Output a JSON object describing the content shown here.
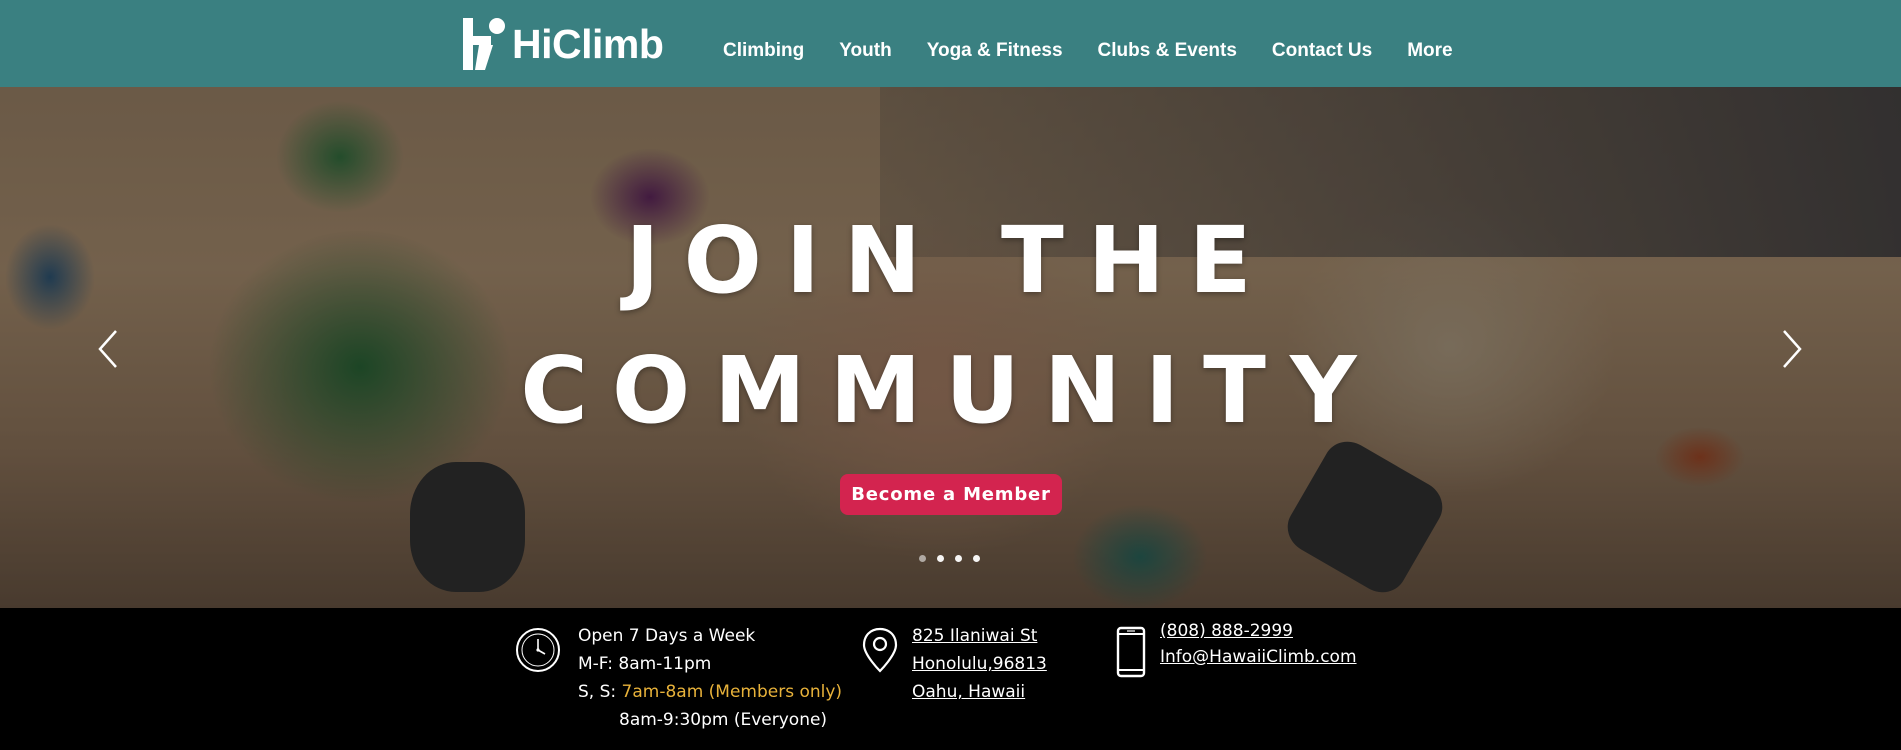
{
  "brand": {
    "name": "HiClimb"
  },
  "nav": {
    "items": [
      {
        "label": "Climbing"
      },
      {
        "label": "Youth"
      },
      {
        "label": "Yoga & Fitness"
      },
      {
        "label": "Clubs & Events"
      },
      {
        "label": "Contact Us"
      },
      {
        "label": "More"
      }
    ]
  },
  "hero": {
    "title_line1": "JOIN THE",
    "title_line2": "COMMUNITY",
    "cta_label": "Become a Member",
    "slide_count": 4,
    "active_slide": 2
  },
  "hours": {
    "line1": "Open 7 Days a Week",
    "line2": "M-F: 8am-11pm",
    "weekend_prefix": "S, S: ",
    "weekend_members": "7am-8am (Members only)",
    "weekend_everyone": "8am-9:30pm (Everyone)"
  },
  "address": {
    "street": "825 Ilaniwai St ",
    "city": "Honolulu,96813 ",
    "region": "Oahu, Hawaii"
  },
  "contact": {
    "phone": "(808) 888-2999 ",
    "email": "Info@HawaiiClimb.com"
  },
  "colors": {
    "header_bg": "#3a8081",
    "cta_bg": "#d3244f",
    "highlight": "#e8b23a",
    "footer_bg": "#000000"
  },
  "icons": {
    "hours": "clock-icon",
    "address": "map-pin-icon",
    "contact": "phone-icon",
    "prev": "chevron-left-icon",
    "next": "chevron-right-icon"
  }
}
